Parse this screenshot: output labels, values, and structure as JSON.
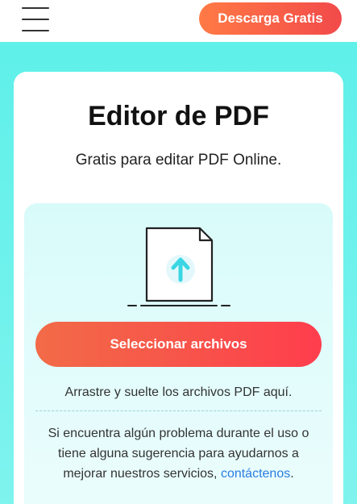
{
  "header": {
    "menu_icon": "hamburger-menu-icon",
    "cta_label": "Descarga Gratis"
  },
  "card": {
    "title": "Editor de PDF",
    "subtitle": "Gratis para editar PDF Online."
  },
  "upload": {
    "icon": "file-upload-icon",
    "button_label": "Seleccionar archivos",
    "drop_hint": "Arrastre y suelte los archivos PDF aquí.",
    "help_text": "Si encuentra algún problema durante el uso o tiene alguna sugerencia para ayudarnos a mejorar nuestros servicios,",
    "help_link": "contáctenos",
    "help_end": "."
  },
  "colors": {
    "accent": "#f24a4a",
    "hero_bg": "#5ff0ea",
    "upload_arrow": "#3ad6e3",
    "link": "#2a7de1"
  }
}
